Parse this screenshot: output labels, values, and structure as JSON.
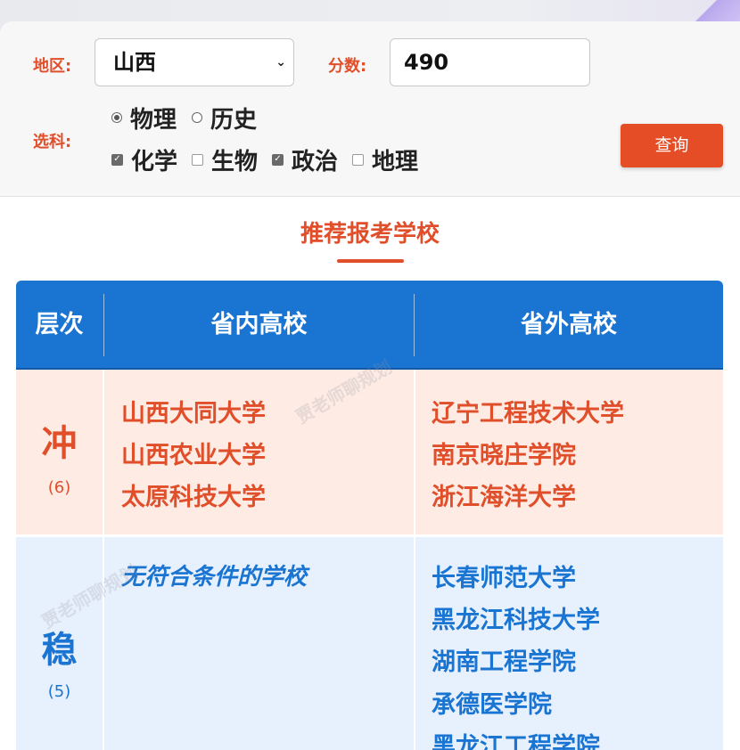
{
  "form": {
    "region_label": "地区:",
    "region_value": "山西",
    "score_label": "分数:",
    "score_value": "490",
    "subjects_label": "选科:",
    "primary_subjects": [
      {
        "label": "物理",
        "selected": true
      },
      {
        "label": "历史",
        "selected": false
      }
    ],
    "elective_subjects": [
      {
        "label": "化学",
        "checked": true
      },
      {
        "label": "生物",
        "checked": false
      },
      {
        "label": "政治",
        "checked": true
      },
      {
        "label": "地理",
        "checked": false
      }
    ],
    "query_button": "查询"
  },
  "section_title": "推荐报考学校",
  "table": {
    "headers": {
      "level": "层次",
      "in_province": "省内高校",
      "out_province": "省外高校"
    },
    "rows": [
      {
        "level": "冲",
        "count": "(6)",
        "in_province": [
          "山西大同大学",
          "山西农业大学",
          "太原科技大学"
        ],
        "out_province": [
          "辽宁工程技术大学",
          "南京晓庄学院",
          "浙江海洋大学"
        ]
      },
      {
        "level": "稳",
        "count": "(5)",
        "in_province_empty": "无符合条件的学校",
        "out_province": [
          "长春师范大学",
          "黑龙江科技大学",
          "湖南工程学院",
          "承德医学院",
          "黑龙江工程学院"
        ]
      }
    ]
  },
  "watermark": "贾老师聊规划",
  "colors": {
    "accent": "#e14e2a",
    "primary": "#1a74d2",
    "chong_bg": "#fdebe4",
    "wen_bg": "#e7f0fd"
  }
}
